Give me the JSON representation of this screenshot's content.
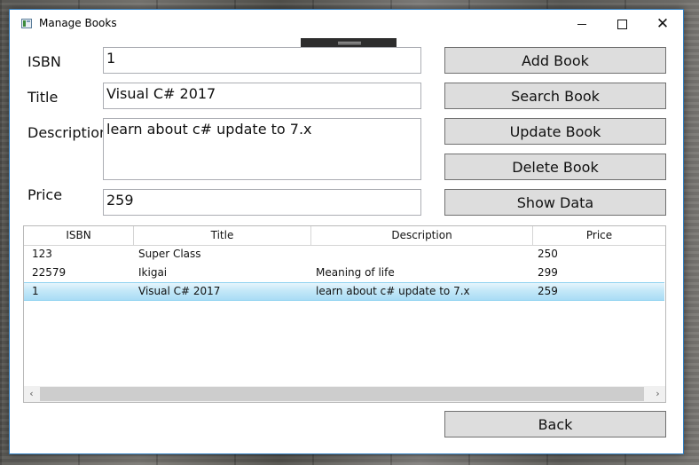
{
  "window": {
    "title": "Manage Books",
    "close_glyph": "✕"
  },
  "form": {
    "isbn_label": "ISBN",
    "isbn_value": "1",
    "title_label": "Title",
    "title_value": "Visual C# 2017",
    "description_label": "Description",
    "description_value": "learn about c# update to 7.x",
    "price_label": "Price",
    "price_value": "259"
  },
  "actions": {
    "add": "Add Book",
    "search": "Search Book",
    "update": "Update Book",
    "delete": "Delete Book",
    "show": "Show Data",
    "back": "Back"
  },
  "grid": {
    "columns": [
      "ISBN",
      "Title",
      "Description",
      "Price"
    ],
    "rows": [
      {
        "isbn": "123",
        "title": "Super Class",
        "description": "",
        "price": "250",
        "selected": false
      },
      {
        "isbn": "22579",
        "title": "Ikigai",
        "description": "Meaning of life",
        "price": "299",
        "selected": false
      },
      {
        "isbn": "1",
        "title": "Visual C# 2017",
        "description": "learn about c# update to 7.x",
        "price": "259",
        "selected": true
      }
    ],
    "scroll_left_glyph": "‹",
    "scroll_right_glyph": "›"
  },
  "icons": [
    "app-icon",
    "minimize-icon",
    "maximize-icon",
    "close-icon",
    "scroll-left-icon",
    "scroll-right-icon"
  ],
  "colors": {
    "window_border": "#2f7dc0",
    "button_bg": "#dddddd",
    "selected_row": "#c4e8f8"
  }
}
